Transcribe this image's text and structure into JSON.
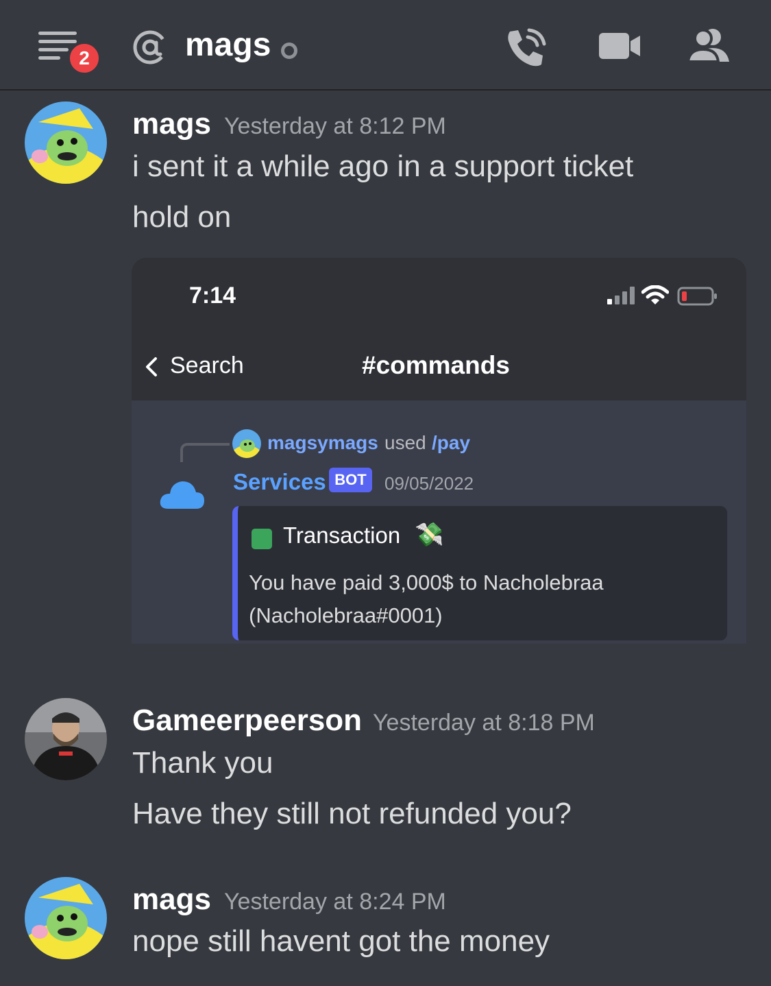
{
  "header": {
    "menu_badge": "2",
    "channel_name": "mags"
  },
  "colors": {
    "background": "#36393f",
    "username_bot": "#5aa2ff",
    "accent_blurple": "#5865f2",
    "badge_red": "#ed4245"
  },
  "icons": [
    "hamburger-menu-icon",
    "at-icon",
    "status-dot-icon",
    "phone-call-icon",
    "video-camera-icon",
    "members-icon"
  ],
  "messages": [
    {
      "author": "mags",
      "time": "Yesterday at 8:12 PM",
      "lines": [
        "i sent it a while ago in a support ticket",
        "hold on"
      ]
    },
    {
      "author": "Gameerpeerson",
      "time": "Yesterday at 8:18 PM",
      "lines": [
        "Thank you",
        "Have they still not refunded you?"
      ]
    },
    {
      "author": "mags",
      "time": "Yesterday at 8:24 PM",
      "lines": [
        "nope still havent got the money"
      ]
    }
  ],
  "screenshot": {
    "clock": "7:14",
    "back_label": "Search",
    "channel": "#commands",
    "reply_user": "magsymags",
    "reply_used": "used",
    "reply_command": "/pay",
    "bot_name": "Services",
    "bot_tag": "BOT",
    "date": "09/05/2022",
    "embed_title": "Transaction",
    "embed_emoji": "💸",
    "embed_line1": "You have paid 3,000$ to Nacholebraa",
    "embed_line2": "(Nacholebraa#0001)"
  }
}
